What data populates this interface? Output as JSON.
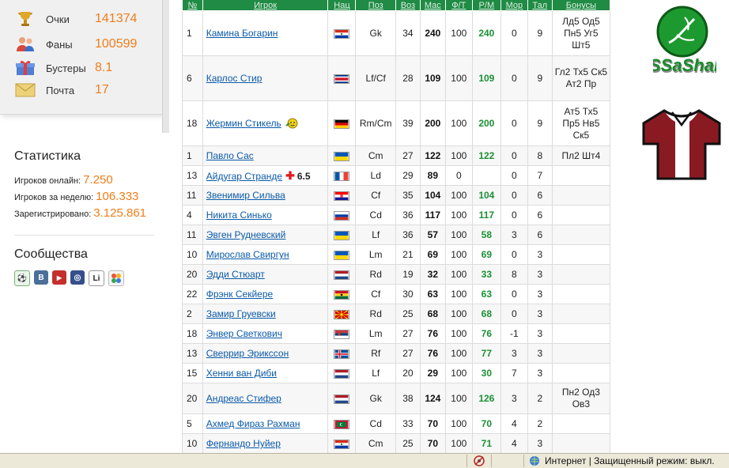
{
  "user_stats": [
    {
      "label": "Очки",
      "value": "141374",
      "icon": "trophy-icon"
    },
    {
      "label": "Фаны",
      "value": "100599",
      "icon": "fans-icon"
    },
    {
      "label": "Бустеры",
      "value": "8.1",
      "icon": "gift-icon"
    },
    {
      "label": "Почта",
      "value": "17",
      "icon": "mail-icon"
    }
  ],
  "statistics": {
    "title": "Статистика",
    "online_label": "Игроков онлайн:",
    "online_value": "7.250",
    "week_label": "Игроков за неделю:",
    "week_value": "106.333",
    "registered_label": "Зарегистрировано:",
    "registered_value": "3.125.861"
  },
  "communities": {
    "title": "Сообщества",
    "icons": [
      {
        "name": "football-icon",
        "text": "⚽",
        "color": "#2c8a2c"
      },
      {
        "name": "vk-icon",
        "text": "B",
        "color": "#4a6f9a"
      },
      {
        "name": "youtube-icon",
        "text": "▶",
        "color": "#c4302b"
      },
      {
        "name": "circle-icon",
        "text": "◎",
        "color": "#34508a"
      },
      {
        "name": "li-icon",
        "text": "Li",
        "color": "#ffffff"
      },
      {
        "name": "dots-icon",
        "text": "●",
        "color": "#e8e8e8"
      }
    ]
  },
  "table": {
    "headers": [
      "№",
      "Игрок",
      "Нац",
      "Поз",
      "Воз",
      "Мас",
      "Ф/Т",
      "Р/М",
      "Мор",
      "Тал",
      "Бонусы"
    ],
    "rows": [
      {
        "n": "1",
        "name": "Камина Богарин",
        "flag": "paraguay",
        "pos": "Gk",
        "age": "34",
        "mas": "240",
        "ft": "100",
        "rm": "240",
        "mor": "0",
        "tal": "9",
        "bonus": "Лд5 Од5 Пн5 Уг5 Шт5",
        "h": "tall"
      },
      {
        "n": "6",
        "name": "Карлос Стир",
        "flag": "costarica",
        "pos": "Lf/Cf",
        "age": "28",
        "mas": "109",
        "ft": "100",
        "rm": "109",
        "mor": "0",
        "tal": "9",
        "bonus": "Гл2 Тх5 Ск5 Ат2 Пр",
        "h": "tall"
      },
      {
        "n": "18",
        "name": "Жермин Стикель",
        "flag": "germany",
        "pos": "Rm/Cm",
        "age": "39",
        "mas": "200",
        "ft": "100",
        "rm": "200",
        "mor": "0",
        "tal": "9",
        "bonus": "Ат5 Тх5 Пр5 Нв5 Ск5",
        "h": "tall",
        "smile": true
      },
      {
        "n": "1",
        "name": "Павло Сас",
        "flag": "ukraine",
        "pos": "Cm",
        "age": "27",
        "mas": "122",
        "ft": "100",
        "rm": "122",
        "mor": "0",
        "tal": "8",
        "bonus": "Пл2 Шт4",
        "h": "row"
      },
      {
        "n": "13",
        "name": "Айдугар Странде",
        "flag": "france",
        "pos": "Ld",
        "age": "29",
        "mas": "89",
        "ft": "0",
        "rm": "",
        "mor": "0",
        "tal": "7",
        "bonus": "",
        "h": "row",
        "injury": "6.5"
      },
      {
        "n": "11",
        "name": "Звенимир Сильва",
        "flag": "croatia",
        "pos": "Cf",
        "age": "35",
        "mas": "104",
        "ft": "100",
        "rm": "104",
        "mor": "0",
        "tal": "6",
        "bonus": "",
        "h": "row"
      },
      {
        "n": "4",
        "name": "Никита Синько",
        "flag": "russia",
        "pos": "Cd",
        "age": "36",
        "mas": "117",
        "ft": "100",
        "rm": "117",
        "mor": "0",
        "tal": "6",
        "bonus": "",
        "h": "row"
      },
      {
        "n": "11",
        "name": "Эвген Рудневский",
        "flag": "ukraine",
        "pos": "Lf",
        "age": "36",
        "mas": "57",
        "ft": "100",
        "rm": "58",
        "mor": "3",
        "tal": "6",
        "bonus": "",
        "h": "row"
      },
      {
        "n": "10",
        "name": "Мирослав Свиргун",
        "flag": "ukraine",
        "pos": "Lm",
        "age": "21",
        "mas": "69",
        "ft": "100",
        "rm": "69",
        "mor": "0",
        "tal": "3",
        "bonus": "",
        "h": "row"
      },
      {
        "n": "20",
        "name": "Эдди Стюарт",
        "flag": "netherlands",
        "pos": "Rd",
        "age": "19",
        "mas": "32",
        "ft": "100",
        "rm": "33",
        "mor": "8",
        "tal": "3",
        "bonus": "",
        "h": "row"
      },
      {
        "n": "22",
        "name": "Фрэнк Секйере",
        "flag": "ghana",
        "pos": "Cf",
        "age": "30",
        "mas": "63",
        "ft": "100",
        "rm": "63",
        "mor": "0",
        "tal": "3",
        "bonus": "",
        "h": "row"
      },
      {
        "n": "2",
        "name": "Замир Груевски",
        "flag": "macedonia",
        "pos": "Rd",
        "age": "25",
        "mas": "68",
        "ft": "100",
        "rm": "68",
        "mor": "0",
        "tal": "3",
        "bonus": "",
        "h": "row"
      },
      {
        "n": "18",
        "name": "Энвер Светкович",
        "flag": "serbia",
        "pos": "Lm",
        "age": "27",
        "mas": "76",
        "ft": "100",
        "rm": "76",
        "mor": "-1",
        "tal": "3",
        "bonus": "",
        "h": "row"
      },
      {
        "n": "13",
        "name": "Сверрир Эрикссон",
        "flag": "iceland",
        "pos": "Rf",
        "age": "27",
        "mas": "76",
        "ft": "100",
        "rm": "77",
        "mor": "3",
        "tal": "3",
        "bonus": "",
        "h": "row"
      },
      {
        "n": "15",
        "name": "Хенни ван Диби",
        "flag": "netherlands",
        "pos": "Lf",
        "age": "20",
        "mas": "29",
        "ft": "100",
        "rm": "30",
        "mor": "7",
        "tal": "3",
        "bonus": "",
        "h": "row"
      },
      {
        "n": "20",
        "name": "Андреас Стифер",
        "flag": "netherlands",
        "pos": "Gk",
        "age": "38",
        "mas": "124",
        "ft": "100",
        "rm": "126",
        "mor": "3",
        "tal": "2",
        "bonus": "Пн2 Од3 Ов3",
        "h": "mid"
      },
      {
        "n": "5",
        "name": "Ахмед Фираз Рахман",
        "flag": "maldives",
        "pos": "Cd",
        "age": "33",
        "mas": "70",
        "ft": "100",
        "rm": "70",
        "mor": "4",
        "tal": "2",
        "bonus": "",
        "h": "row"
      },
      {
        "n": "10",
        "name": "Фернандо Нуйер",
        "flag": "paraguay",
        "pos": "Cm",
        "age": "25",
        "mas": "70",
        "ft": "100",
        "rm": "71",
        "mor": "4",
        "tal": "3",
        "bonus": "",
        "h": "row"
      }
    ]
  },
  "club": {
    "logo_text": "SSaShaN"
  },
  "statusbar": {
    "zone_text": "Интернет | Защищенный режим: выкл."
  },
  "colors": {
    "header_green": "#1f8b44",
    "accent_orange": "#f07d1a",
    "rm_green": "#1a9133",
    "link_blue": "#0b5aa8"
  }
}
